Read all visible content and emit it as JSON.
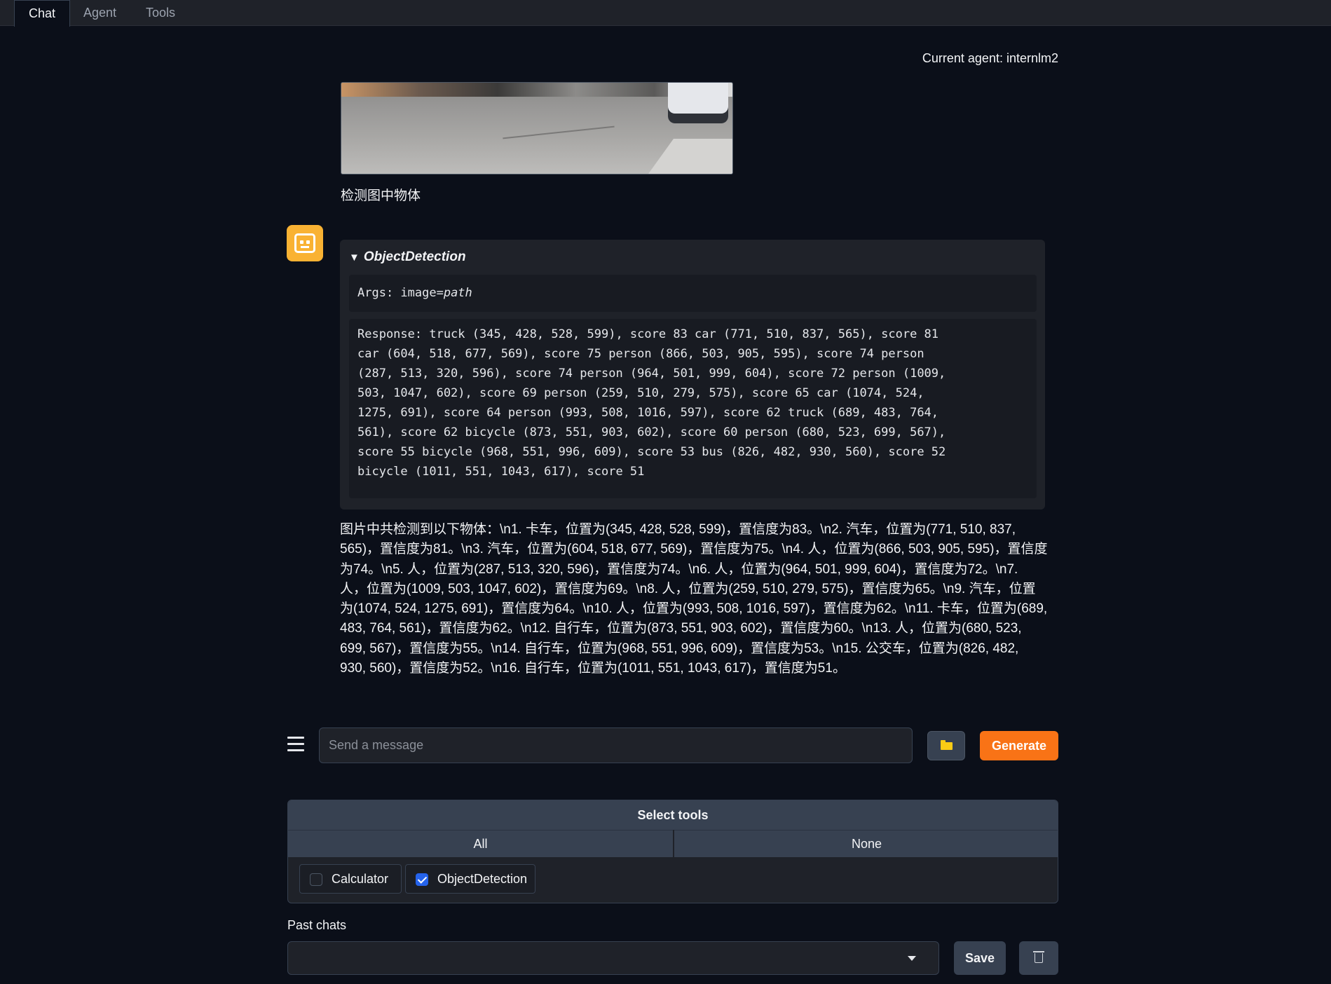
{
  "tabs": [
    {
      "label": "Chat"
    },
    {
      "label": "Agent"
    },
    {
      "label": "Tools"
    }
  ],
  "header": {
    "current_agent": "Current agent: internlm2"
  },
  "user_message": {
    "text": "检测图中物体"
  },
  "tool_call": {
    "name": "ObjectDetection",
    "args_prefix": "Args: image=",
    "args_value": "path",
    "response": "Response: truck (345, 428, 528, 599), score 83 car (771, 510, 837, 565), score 81\ncar (604, 518, 677, 569), score 75 person (866, 503, 905, 595), score 74 person\n(287, 513, 320, 596), score 74 person (964, 501, 999, 604), score 72 person (1009,\n503, 1047, 602), score 69 person (259, 510, 279, 575), score 65 car (1074, 524,\n1275, 691), score 64 person (993, 508, 1016, 597), score 62 truck (689, 483, 764,\n561), score 62 bicycle (873, 551, 903, 602), score 60 person (680, 523, 699, 567),\nscore 55 bicycle (968, 551, 996, 609), score 53 bus (826, 482, 930, 560), score 52\nbicycle (1011, 551, 1043, 617), score 51"
  },
  "answer": {
    "text": "图片中共检测到以下物体：\\n1. 卡车，位置为(345, 428, 528, 599)，置信度为83。\\n2. 汽车，位置为(771, 510, 837, 565)，置信度为81。\\n3. 汽车，位置为(604, 518, 677, 569)，置信度为75。\\n4. 人，位置为(866, 503, 905, 595)，置信度为74。\\n5. 人，位置为(287, 513, 320, 596)，置信度为74。\\n6. 人，位置为(964, 501, 999, 604)，置信度为72。\\n7. 人，位置为(1009, 503, 1047, 602)，置信度为69。\\n8. 人，位置为(259, 510, 279, 575)，置信度为65。\\n9. 汽车，位置为(1074, 524, 1275, 691)，置信度为64。\\n10. 人，位置为(993, 508, 1016, 597)，置信度为62。\\n11. 卡车，位置为(689, 483, 764, 561)，置信度为62。\\n12. 自行车，位置为(873, 551, 903, 602)，置信度为60。\\n13. 人，位置为(680, 523, 699, 567)，置信度为55。\\n14. 自行车，位置为(968, 551, 996, 609)，置信度为53。\\n15. 公交车，位置为(826, 482, 930, 560)，置信度为52。\\n16. 自行车，位置为(1011, 551, 1043, 617)，置信度为51。"
  },
  "composer": {
    "placeholder": "Send a message",
    "generate_label": "Generate",
    "upload_icon": "folder-icon",
    "menu_icon": "menu-icon"
  },
  "tools_panel": {
    "title": "Select tools",
    "all_label": "All",
    "none_label": "None",
    "tools": [
      {
        "label": "Calculator",
        "checked": false
      },
      {
        "label": "ObjectDetection",
        "checked": true
      }
    ]
  },
  "past_chats": {
    "label": "Past chats",
    "selected": "",
    "save_label": "Save",
    "delete_icon": "trash-icon"
  },
  "colors": {
    "background": "#0b0f19",
    "accent": "#f97316",
    "avatar": "#f9b233",
    "checkbox": "#2563eb"
  }
}
